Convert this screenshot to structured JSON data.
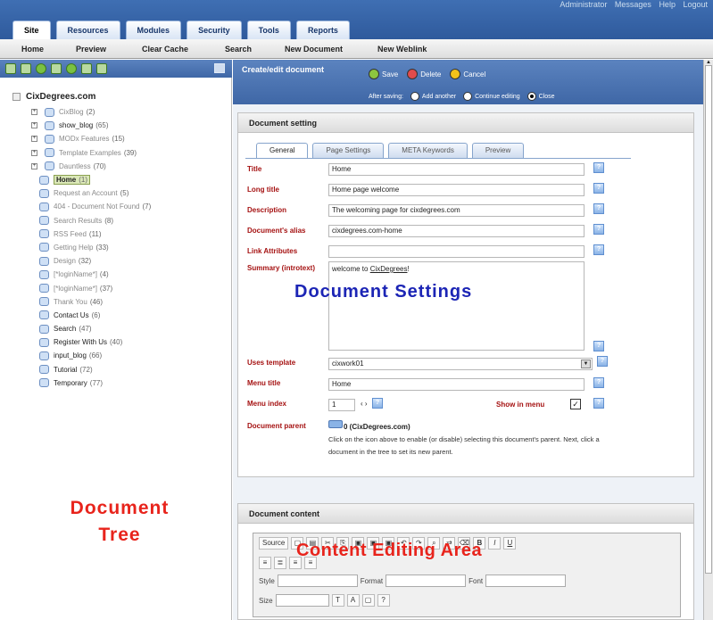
{
  "header": {
    "user_links": [
      "Administrator",
      "Messages",
      "Help",
      "Logout"
    ],
    "tabs": [
      "Site",
      "Resources",
      "Modules",
      "Security",
      "Tools",
      "Reports"
    ]
  },
  "submenu": [
    "Home",
    "Preview",
    "Clear Cache",
    "Search",
    "New Document",
    "New Weblink"
  ],
  "tree": {
    "root": "CixDegrees.com",
    "items": [
      {
        "label": "CixBlog",
        "count": "(2)",
        "expand": "+",
        "grey": true
      },
      {
        "label": "show_blog",
        "count": "(65)",
        "expand": "+"
      },
      {
        "label": "MODx Features",
        "count": "(15)",
        "expand": "+",
        "grey": true
      },
      {
        "label": "Template Examples",
        "count": "(39)",
        "expand": "+",
        "grey": true
      },
      {
        "label": "Dauntless",
        "count": "(70)",
        "expand": "+",
        "grey": true
      },
      {
        "label": "Home",
        "count": "(1)",
        "selected": true
      },
      {
        "label": "Request an Account",
        "count": "(5)",
        "grey": true
      },
      {
        "label": "404 - Document Not Found",
        "count": "(7)",
        "grey": true
      },
      {
        "label": "Search Results",
        "count": "(8)",
        "grey": true
      },
      {
        "label": "RSS Feed",
        "count": "(11)",
        "grey": true
      },
      {
        "label": "Getting Help",
        "count": "(33)",
        "grey": true
      },
      {
        "label": "Design",
        "count": "(32)",
        "grey": true
      },
      {
        "label": "[*loginName*]",
        "count": "(4)",
        "grey": true
      },
      {
        "label": "[*loginName*]",
        "count": "(37)",
        "grey": true
      },
      {
        "label": "Thank You",
        "count": "(46)",
        "grey": true
      },
      {
        "label": "Contact Us",
        "count": "(6)"
      },
      {
        "label": "Search",
        "count": "(47)"
      },
      {
        "label": "Register With Us",
        "count": "(40)"
      },
      {
        "label": "input_blog",
        "count": "(66)"
      },
      {
        "label": "Tutorial",
        "count": "(72)"
      },
      {
        "label": "Temporary",
        "count": "(77)"
      }
    ],
    "overlay_line1": "Document",
    "overlay_line2": "Tree"
  },
  "actions": {
    "title": "Create/edit document",
    "save": "Save",
    "delete": "Delete",
    "cancel": "Cancel",
    "after_saving": "After saving:",
    "add_another": "Add another",
    "continue_editing": "Continue editing",
    "close": "Close",
    "colors": {
      "save": "#8dc63f",
      "delete": "#e14b4b",
      "cancel": "#f3c21a"
    }
  },
  "doc_setting": {
    "header": "Document setting",
    "tabs": [
      "General",
      "Page Settings",
      "META Keywords",
      "Preview"
    ],
    "fields": {
      "title_label": "Title",
      "title_value": "Home",
      "longtitle_label": "Long title",
      "longtitle_value": "Home page welcome",
      "description_label": "Description",
      "description_value": "The welcoming page for cixdegrees.com",
      "alias_label": "Document's alias",
      "alias_value": "cixdegrees.com-home",
      "link_label": "Link Attributes",
      "link_value": "",
      "summary_label": "Summary (introtext)",
      "summary_prefix": "welcome to ",
      "summary_link": "CixDegrees",
      "summary_suffix": "!",
      "template_label": "Uses template",
      "template_value": "cixwork01",
      "menutitle_label": "Menu title",
      "menutitle_value": "Home",
      "menuindex_label": "Menu index",
      "menuindex_value": "1",
      "show_in_menu": "Show in menu",
      "parent_label": "Document parent",
      "parent_value": "0 (CixDegrees.com)",
      "parent_help": "Click on the icon above to enable (or disable) selecting this document's parent. Next, click a document in the tree to set its new parent."
    },
    "overlay": "Document Settings"
  },
  "doc_content": {
    "header": "Document content",
    "source": "Source",
    "style": "Style",
    "format": "Format",
    "font": "Font",
    "size": "Size",
    "overlay": "Content Editing Area"
  }
}
